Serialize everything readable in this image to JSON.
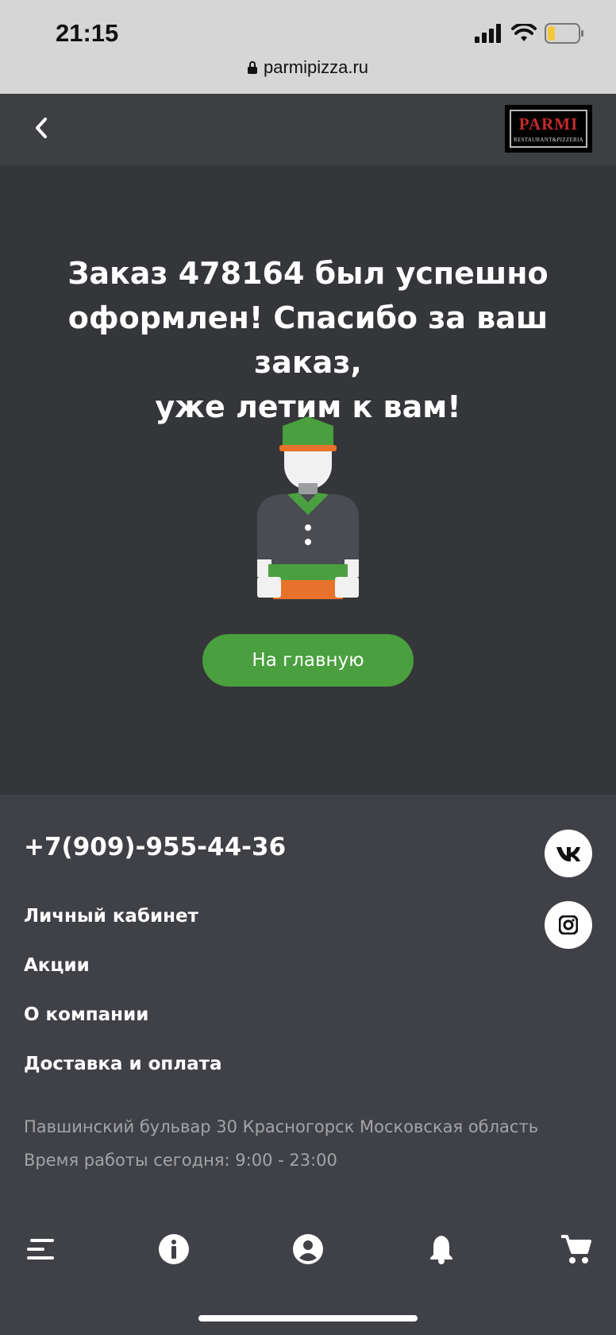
{
  "status_bar": {
    "time": "21:15",
    "url": "parmipizza.ru"
  },
  "header": {
    "back_icon": "chevron-left-icon",
    "logo_text": "PARMI",
    "logo_subtext": "RESTAURANT&PIZZERIA"
  },
  "main": {
    "title_line1": "Заказ 478164 был успешно",
    "title_line2": "оформлен! Спасибо за ваш заказ,",
    "title_line3": "уже летим к вам!",
    "home_button_label": "На главную",
    "accent_color": "#4aa03f"
  },
  "footer": {
    "phone": "+7(909)-955-44-36",
    "social": [
      "vk-icon",
      "instagram-icon"
    ],
    "links": [
      "Личный кабинет",
      "Акции",
      "О компании",
      "Доставка и оплата"
    ],
    "address": "Павшинский бульвар 30 Красногорск Московская область",
    "hours": "Время работы сегодня: 9:00 - 23:00"
  },
  "bottom_nav": [
    "menu-icon",
    "info-icon",
    "account-icon",
    "bell-icon",
    "cart-icon"
  ]
}
